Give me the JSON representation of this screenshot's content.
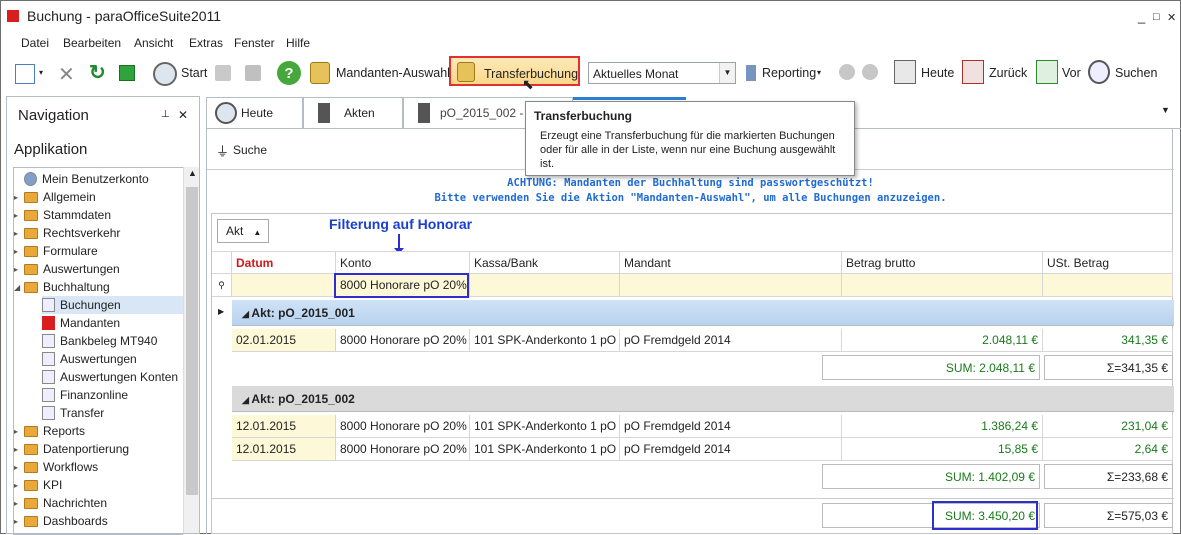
{
  "window": {
    "title": "Buchung - paraOfficeSuite2011",
    "min": "_",
    "max": "□",
    "close": "✕"
  },
  "menu": [
    "Datei",
    "Bearbeiten",
    "Ansicht",
    "Extras",
    "Fenster",
    "Hilfe"
  ],
  "toolbar": {
    "start": "Start",
    "mandanten": "Mandanten-Auswahl",
    "transfer": "Transferbuchung",
    "period": "Aktuelles Monat",
    "reporting": "Reporting",
    "heute": "Heute",
    "zurueck": "Zurück",
    "vor": "Vor",
    "suchen": "Suchen"
  },
  "nav": {
    "title": "Navigation",
    "pin": "⊥",
    "close": "✕",
    "section": "Applikation",
    "items": [
      {
        "label": "Mein Benutzerkonto",
        "type": "user"
      },
      {
        "label": "Allgemein",
        "type": "folder"
      },
      {
        "label": "Stammdaten",
        "type": "folder"
      },
      {
        "label": "Rechtsverkehr",
        "type": "folder"
      },
      {
        "label": "Formulare",
        "type": "folder"
      },
      {
        "label": "Auswertungen",
        "type": "folder"
      },
      {
        "label": "Buchhaltung",
        "type": "folder-open"
      },
      {
        "label": "Buchungen",
        "type": "leaf"
      },
      {
        "label": "Mandanten",
        "type": "leaf"
      },
      {
        "label": "Bankbeleg MT940",
        "type": "leaf"
      },
      {
        "label": "Auswertungen",
        "type": "leaf"
      },
      {
        "label": "Auswertungen Konten",
        "type": "leaf"
      },
      {
        "label": "Finanzonline",
        "type": "leaf"
      },
      {
        "label": "Transfer",
        "type": "leaf"
      },
      {
        "label": "Reports",
        "type": "folder"
      },
      {
        "label": "Datenportierung",
        "type": "folder"
      },
      {
        "label": "Workflows",
        "type": "folder"
      },
      {
        "label": "KPI",
        "type": "folder"
      },
      {
        "label": "Nachrichten",
        "type": "folder"
      },
      {
        "label": "Dashboards",
        "type": "folder"
      }
    ]
  },
  "tabs": [
    "Heute",
    "Akten",
    "pO_2015_002 -"
  ],
  "content": {
    "search": "Suche",
    "warn1": "ACHTUNG: Mandanten der Buchhaltung sind passwortgeschützt!",
    "warn2": "Bitte verwenden Sie die Aktion \"Mandanten-Auswahl\", um alle Buchungen anzuzeigen.",
    "group_btn": "Akt",
    "annotation": "Filterung auf Honorar",
    "columns": [
      "Datum",
      "Konto",
      "Kassa/Bank",
      "Mandant",
      "Betrag brutto",
      "USt. Betrag"
    ],
    "filter": "8000 Honorare pO 20%",
    "groups": [
      {
        "label": "Akt: pO_2015_001",
        "rows": [
          {
            "datum": "02.01.2015",
            "konto": "8000 Honorare pO 20%",
            "kassa": "101 SPK-Anderkonto 1 pO",
            "mandant": "pO Fremdgeld  2014",
            "betrag": "2.048,11 €",
            "ust": "341,35 €"
          }
        ],
        "sum": "SUM: 2.048,11 €",
        "ustsum": "Σ=341,35 €"
      },
      {
        "label": "Akt: pO_2015_002",
        "rows": [
          {
            "datum": "12.01.2015",
            "konto": "8000 Honorare pO 20%",
            "kassa": "101 SPK-Anderkonto 1 pO",
            "mandant": "pO Fremdgeld  2014",
            "betrag": "1.386,24 €",
            "ust": "231,04 €"
          },
          {
            "datum": "12.01.2015",
            "konto": "8000 Honorare pO 20%",
            "kassa": "101 SPK-Anderkonto 1 pO",
            "mandant": "pO Fremdgeld  2014",
            "betrag": "15,85 €",
            "ust": "2,64 €"
          }
        ],
        "sum": "SUM: 1.402,09 €",
        "ustsum": "Σ=233,68 €"
      }
    ],
    "total": "SUM: 3.450,20 €",
    "ust_total": "Σ=575,03 €"
  },
  "tooltip": {
    "title": "Transferbuchung",
    "body": "Erzeugt eine Transferbuchung für die markierten Buchungen oder für alle in der Liste, wenn nur eine Buchung ausgewählt ist."
  }
}
